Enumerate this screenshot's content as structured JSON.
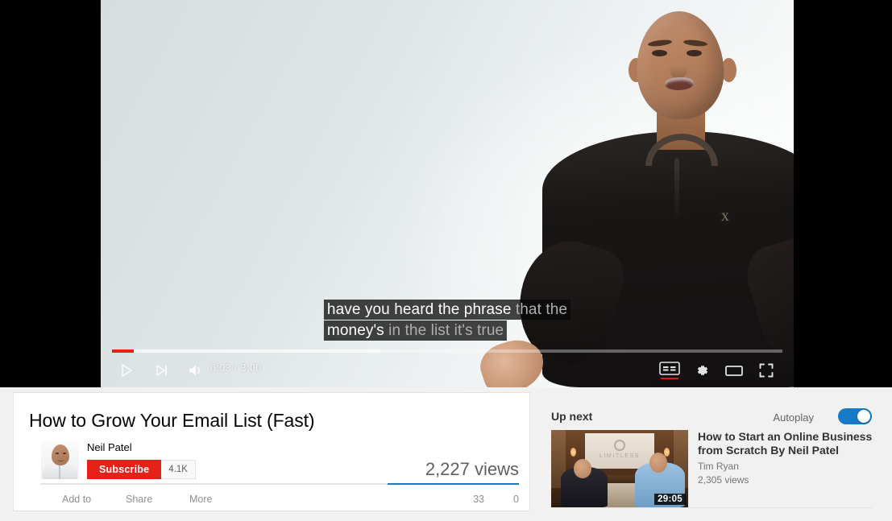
{
  "player": {
    "captions": {
      "line1_said": "have you heard the phrase",
      "line1_next": "that the",
      "line2_said": "money's",
      "line2_next": "in the list it's true"
    },
    "controls": {
      "play_label": "Play",
      "next_label": "Next video",
      "volume_label": "Volume",
      "time_display": "0:03 / 3:00",
      "current_time": "0:03",
      "duration": "3:00",
      "cc_label": "CC",
      "settings_label": "Settings",
      "theater_label": "Theater mode",
      "fullscreen_label": "Fullscreen",
      "progress_played_percent": 3.2,
      "progress_loaded_percent": 40
    },
    "colors": {
      "progress_played": "#e62117",
      "cc_active_underline": "#e62117"
    }
  },
  "primary": {
    "title": "How to Grow Your Email List (Fast)",
    "owner_name": "Neil Patel",
    "subscribe_label": "Subscribe",
    "subscriber_count": "4.1K",
    "view_count": "2,227 views",
    "actions": [
      {
        "label": "Add to"
      },
      {
        "label": "Share"
      },
      {
        "label": "More"
      }
    ],
    "like_count": "33",
    "dislike_count": "0",
    "colors": {
      "subscribe_bg": "#e62117",
      "sentiment_fill": "#167ac6"
    }
  },
  "secondary": {
    "up_next_label": "Up next",
    "autoplay_label": "Autoplay",
    "autoplay_on": true,
    "up_next": {
      "title": "How to Start an Online Business from Scratch By Neil Patel",
      "channel": "Tim Ryan",
      "views": "2,305 views",
      "duration": "29:05",
      "thumbnail_text": "LIMITLESS"
    },
    "colors": {
      "toggle_on": "#167ac6"
    }
  }
}
